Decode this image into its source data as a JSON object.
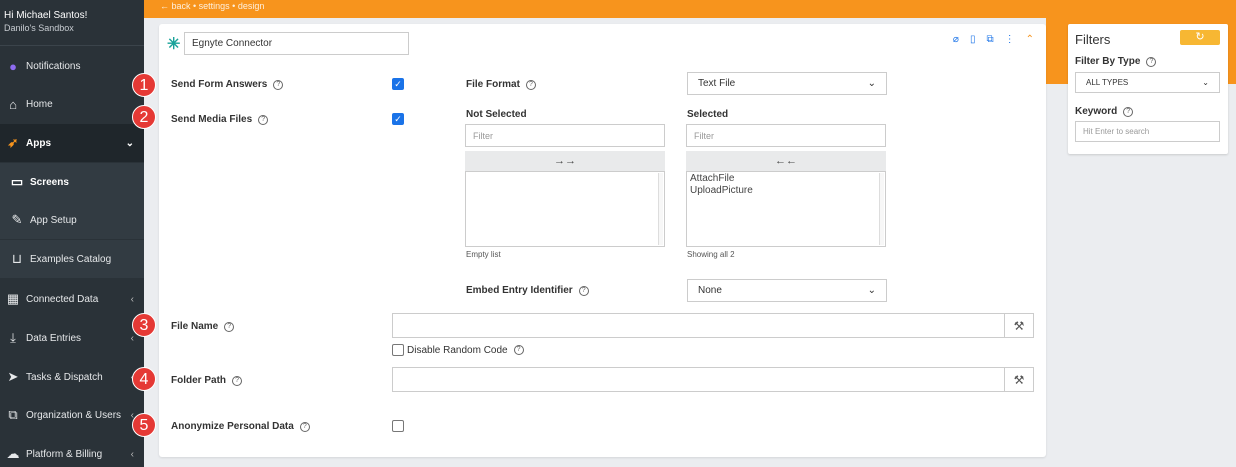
{
  "sidebar": {
    "greeting": "Hi Michael Santos!",
    "account": "Danilo's Sandbox",
    "items": [
      {
        "label": "Notifications",
        "icon": "bell-icon",
        "glyph": "🔔"
      },
      {
        "label": "Home",
        "icon": "home-icon",
        "glyph": "⌂"
      },
      {
        "label": "Apps",
        "icon": "rocket-icon",
        "glyph": "🚀"
      },
      {
        "label": "Screens",
        "icon": "screens-icon",
        "glyph": "▭"
      },
      {
        "label": "App Setup",
        "icon": "wrench-icon",
        "glyph": "🔧"
      },
      {
        "label": "Examples Catalog",
        "icon": "basket-icon",
        "glyph": "🧺"
      },
      {
        "label": "Connected Data",
        "icon": "table-icon",
        "glyph": "▦"
      },
      {
        "label": "Data Entries",
        "icon": "inbox-icon",
        "glyph": "📥"
      },
      {
        "label": "Tasks & Dispatch",
        "icon": "paper-plane-icon",
        "glyph": "➤"
      },
      {
        "label": "Organization & Users",
        "icon": "org-chart-icon",
        "glyph": "⧉"
      },
      {
        "label": "Platform & Billing",
        "icon": "users-cog-icon",
        "glyph": "☁"
      }
    ]
  },
  "breadcrumb": "← back • settings • design",
  "connector": {
    "name": "Egnyte Connector"
  },
  "form": {
    "send_form_answers": "Send Form Answers",
    "send_media_files": "Send Media Files",
    "file_format_label": "File Format",
    "file_format_value": "Text File",
    "not_selected_label": "Not Selected",
    "selected_label": "Selected",
    "filter_placeholder": "Filter",
    "move_right": "→→",
    "move_left": "←←",
    "not_selected_items": [],
    "selected_items": [
      "AttachFile",
      "UploadPicture"
    ],
    "empty_list_text": "Empty list",
    "showing_text": "Showing all 2",
    "embed_entry_label": "Embed Entry Identifier",
    "embed_entry_value": "None",
    "file_name_label": "File Name",
    "disable_random_code": "Disable Random Code",
    "folder_path_label": "Folder Path",
    "anonymize_label": "Anonymize Personal Data",
    "send_form_answers_checked": true,
    "send_media_files_checked": true,
    "disable_random_code_checked": false,
    "anonymize_checked": false
  },
  "badges": [
    "1",
    "2",
    "3",
    "4",
    "5"
  ],
  "filters": {
    "title": "Filters",
    "filter_by_type_label": "Filter By Type",
    "filter_by_type_value": "ALL TYPES",
    "keyword_label": "Keyword",
    "keyword_placeholder": "Hit Enter to search"
  },
  "colors": {
    "accent": "#f7941d",
    "sidebar": "#2a3238",
    "badge": "#e53935",
    "checkbox": "#1a73e8",
    "connector_icon": "#1aa39a"
  }
}
